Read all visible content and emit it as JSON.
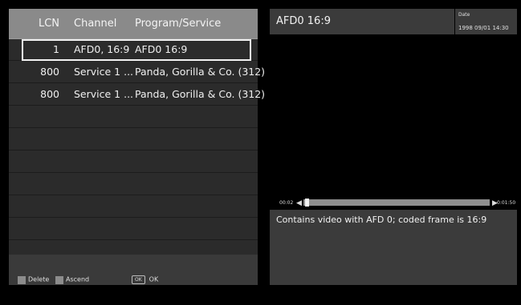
{
  "list": {
    "headers": {
      "lcn": "LCN",
      "channel": "Channel",
      "program": "Program/Service"
    },
    "rows": [
      {
        "lcn": "1",
        "channel": "AFD0, 16:9",
        "program": "AFD0 16:9",
        "selected": true
      },
      {
        "lcn": "800",
        "channel": "Service 1 ...",
        "program": "Panda, Gorilla & Co. (312)",
        "selected": false
      },
      {
        "lcn": "800",
        "channel": "Service 1 ...",
        "program": "Panda, Gorilla & Co. (312)",
        "selected": false
      }
    ],
    "empty_row_count": 7
  },
  "footer": {
    "delete_label": "Delete",
    "ascend_label": "Ascend",
    "ok_key": "OK",
    "ok_label": "OK",
    "key_color": "#8c8c8c"
  },
  "info": {
    "title": "AFD0 16:9",
    "date_label": "Date",
    "date_value": "1998 09/01 14:30",
    "time_start": "00:02",
    "time_end": "0:01:50",
    "progress": 0.01,
    "description": "Contains video with AFD 0; coded frame is 16:9"
  },
  "colors": {
    "panel": "#2b2b2b",
    "header": "#8a8a8a",
    "info_bar": "#3b3b3b",
    "track": "#8f8f8f"
  }
}
